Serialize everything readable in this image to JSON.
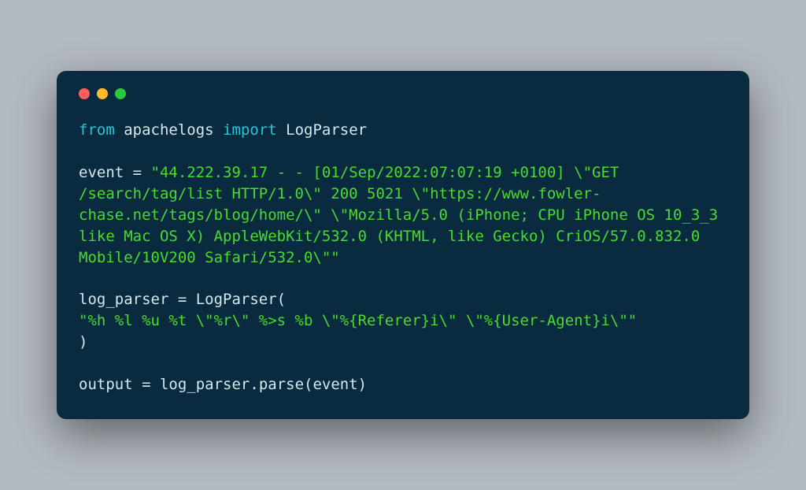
{
  "code": {
    "line1": {
      "from": "from",
      "module": "apachelogs",
      "import": "import",
      "name": "LogParser"
    },
    "line3": {
      "var": "event",
      "eq": " = ",
      "str": "\"44.222.39.17 - - [01/Sep/2022:07:07:19 +0100] \\\"GET /search/tag/list HTTP/1.0\\\" 200 5021 \\\"https://www.fowler-chase.net/tags/blog/home/\\\" \\\"Mozilla/5.0 (iPhone; CPU iPhone OS 10_3_3 like Mac OS X) AppleWebKit/532.0 (KHTML, like Gecko) CriOS/57.0.832.0 Mobile/10V200 Safari/532.0\\\"\""
    },
    "line5": {
      "var": "log_parser",
      "eq": " = ",
      "call": "LogParser(",
      "fmt": "\"%h %l %u %t \\\"%r\\\" %>s %b \\\"%{Referer}i\\\" \\\"%{User-Agent}i\\\"\"",
      "close": ")"
    },
    "line7": {
      "var": "output",
      "eq": " = ",
      "obj": "log_parser",
      "dot": ".",
      "method": "parse",
      "open": "(",
      "arg": "event",
      "close": ")"
    }
  }
}
